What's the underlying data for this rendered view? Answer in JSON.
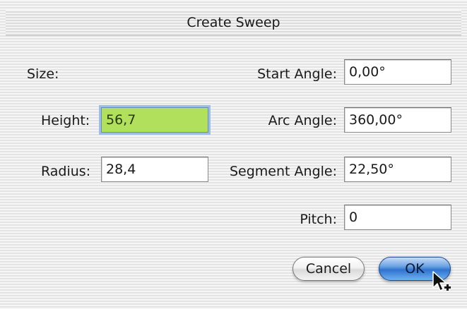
{
  "dialog": {
    "title": "Create Sweep"
  },
  "size_label": "Size:",
  "height": {
    "label": "Height:",
    "value": "56,7"
  },
  "radius": {
    "label": "Radius:",
    "value": "28,4"
  },
  "start_angle": {
    "label": "Start Angle:",
    "value": "0,00°"
  },
  "arc_angle": {
    "label": "Arc Angle:",
    "value": "360,00°"
  },
  "segment_angle": {
    "label": "Segment Angle:",
    "value": "22,50°"
  },
  "pitch": {
    "label": "Pitch:",
    "value": "0"
  },
  "buttons": {
    "cancel_label": "Cancel",
    "ok_label": "OK"
  },
  "colors": {
    "focused_field": "#b1e05c",
    "default_button": "#2f73cf",
    "focus_ring": "#9bbde6"
  },
  "icons": {
    "cursor": "arrow-copy-cursor-icon"
  }
}
